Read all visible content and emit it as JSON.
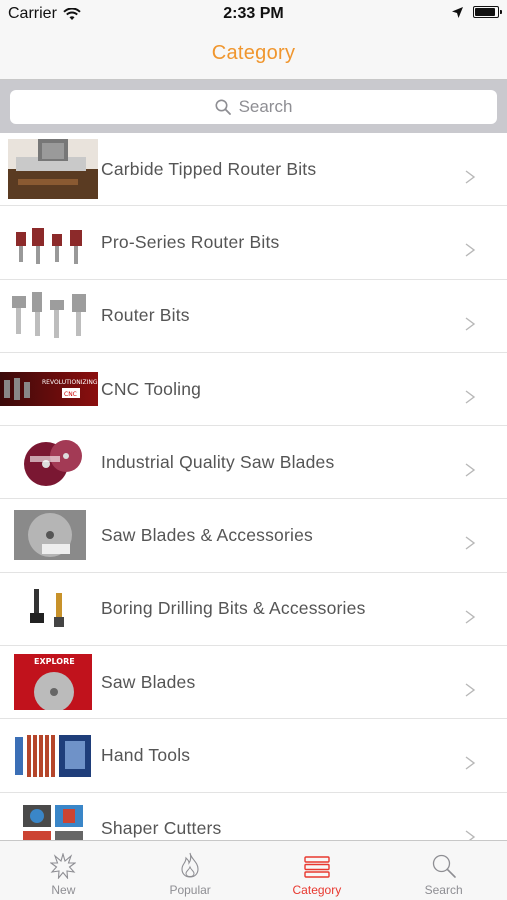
{
  "status_bar": {
    "carrier": "Carrier",
    "time": "2:33 PM"
  },
  "nav": {
    "title": "Category"
  },
  "search": {
    "placeholder": "Search"
  },
  "categories": [
    {
      "label": "Carbide Tipped Router Bits",
      "thumb": "router-table-photo"
    },
    {
      "label": "Pro-Series Router Bits",
      "thumb": "pro-router-bits-photo"
    },
    {
      "label": "Router Bits",
      "thumb": "router-bits-photo"
    },
    {
      "label": "CNC Tooling",
      "thumb": "cnc-banner",
      "thumb_text": "REVOLUTIONIZING"
    },
    {
      "label": "Industrial Quality Saw Blades",
      "thumb": "saw-blades-photo"
    },
    {
      "label": "Saw Blades & Accessories",
      "thumb": "saw-blade-box-photo"
    },
    {
      "label": "Boring Drilling Bits & Accessories",
      "thumb": "boring-bits-photo"
    },
    {
      "label": "Saw Blades",
      "thumb": "explore-saw-blades",
      "thumb_text": "EXPLORE"
    },
    {
      "label": "Hand Tools",
      "thumb": "hand-tools-photo"
    },
    {
      "label": "Shaper Cutters",
      "thumb": "shaper-cutters-photo"
    }
  ],
  "tabs": [
    {
      "label": "New",
      "icon": "starburst-icon",
      "active": false
    },
    {
      "label": "Popular",
      "icon": "flame-icon",
      "active": false
    },
    {
      "label": "Category",
      "icon": "list-icon",
      "active": true
    },
    {
      "label": "Search",
      "icon": "magnifier-icon",
      "active": false
    }
  ],
  "colors": {
    "accent": "#f0962e",
    "active_tab": "#e8382f",
    "inactive_tab": "#8e8e93"
  }
}
